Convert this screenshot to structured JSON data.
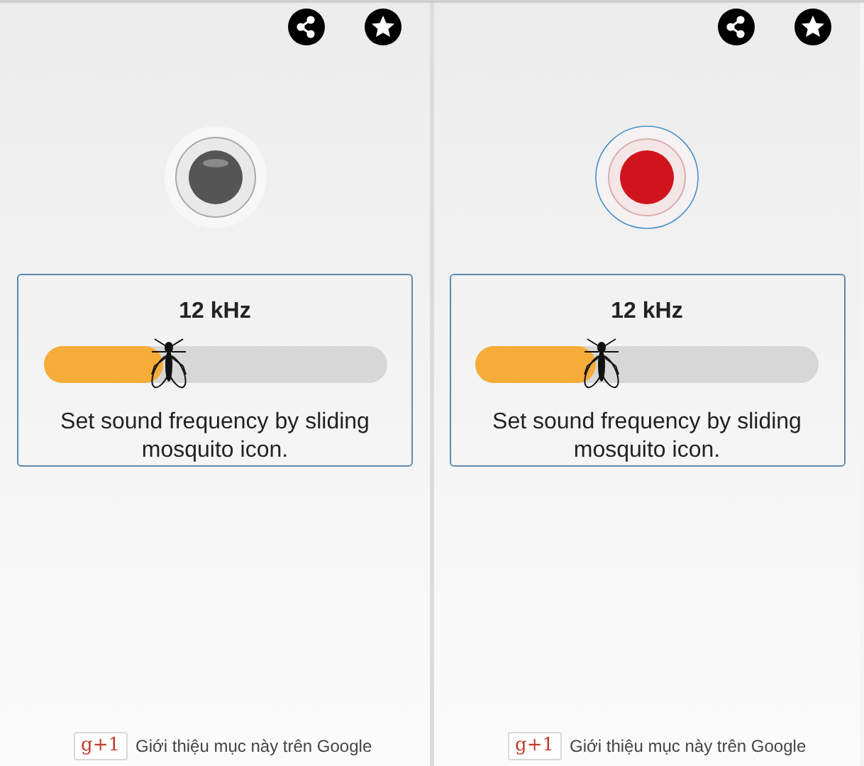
{
  "panels": [
    {
      "recording": false,
      "frequency": "12 kHz",
      "slider": {
        "level": 0.35
      },
      "hint": "Set sound frequency by sliding mosquito icon.",
      "plus_one": {
        "badge": "g+1",
        "label": "Giới thiệu mục này trên Google"
      }
    },
    {
      "recording": true,
      "frequency": "12 kHz",
      "slider": {
        "level": 0.35
      },
      "hint": "Set sound frequency by sliding mosquito icon.",
      "plus_one": {
        "badge": "g+1",
        "label": "Giới thiệu mục này trên Google"
      }
    }
  ]
}
